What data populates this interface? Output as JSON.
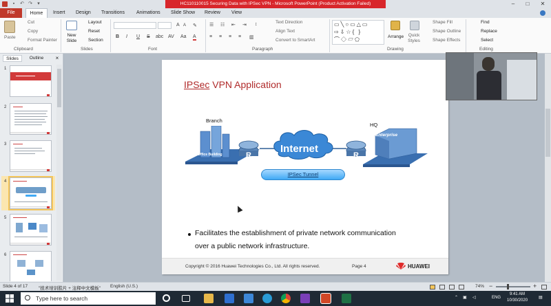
{
  "window": {
    "title": "HC110110015 Securing Data with IPSec VPN - Microsoft PowerPoint (Product Activation Failed)",
    "controls": [
      "–",
      "□",
      "✕"
    ]
  },
  "tabs": [
    "File",
    "Home",
    "Insert",
    "Design",
    "Transitions",
    "Animations",
    "Slide Show",
    "Review",
    "View"
  ],
  "ribbon": {
    "clipboard": {
      "label": "Clipboard",
      "paste": "Paste",
      "cut": "Cut",
      "copy": "Copy",
      "format_painter": "Format Painter"
    },
    "slides": {
      "label": "Slides",
      "new_slide": "New Slide",
      "layout": "Layout",
      "reset": "Reset",
      "section": "Section"
    },
    "font": {
      "label": "Font",
      "bold": "B",
      "italic": "I",
      "underline": "U",
      "strike": "S",
      "shadow": "abc",
      "spacing": "AV",
      "case": "Aa",
      "color": "A",
      "grow": "A",
      "shrink": "A"
    },
    "paragraph": {
      "label": "Paragraph",
      "text_direction": "Text Direction",
      "align_text": "Align Text",
      "convert_smartart": "Convert to SmartArt"
    },
    "drawing": {
      "label": "Drawing",
      "arrange": "Arrange",
      "quick_styles": "Quick Styles",
      "shape_fill": "Shape Fill",
      "shape_outline": "Shape Outline",
      "shape_effects": "Shape Effects"
    },
    "editing": {
      "label": "Editing",
      "find": "Find",
      "replace": "Replace",
      "select": "Select"
    }
  },
  "pane": {
    "tabs": [
      "Slides",
      "Outline"
    ],
    "close": "×",
    "slides": [
      "1",
      "2",
      "3",
      "4",
      "5",
      "6"
    ]
  },
  "slide": {
    "title_underlined": "IPSec",
    "title_rest": " VPN Application",
    "branch": "Branch",
    "hq": "HQ",
    "office_building": "Office Building",
    "enterprise": "Enterprise",
    "router_letter": "R",
    "internet": "Internet",
    "tunnel": "IPSec Tunnel",
    "bullet_line1": "Facilitates the establishment of private network communication",
    "bullet_line2": "over a public network infrastructure.",
    "footer_copyright": "Copyright © 2016 Huawei Technologies Co., Ltd. All rights reserved.",
    "footer_page": "Page 4",
    "footer_brand": "HUAWEI"
  },
  "status": {
    "slide_info": "Slide 4 of 17",
    "theme": "\"技术培训胶片 + 注释中文模板\"",
    "language": "English (U.S.)",
    "zoom": "74%"
  },
  "taskbar": {
    "search_placeholder": "Type here to search",
    "lang": "ENG",
    "time": "9:41 AM",
    "date": "10/30/2020"
  },
  "colors": {
    "accent": "#c0392b",
    "tunnel": "#3fa9f5",
    "taskbar": "#1f2a35"
  }
}
